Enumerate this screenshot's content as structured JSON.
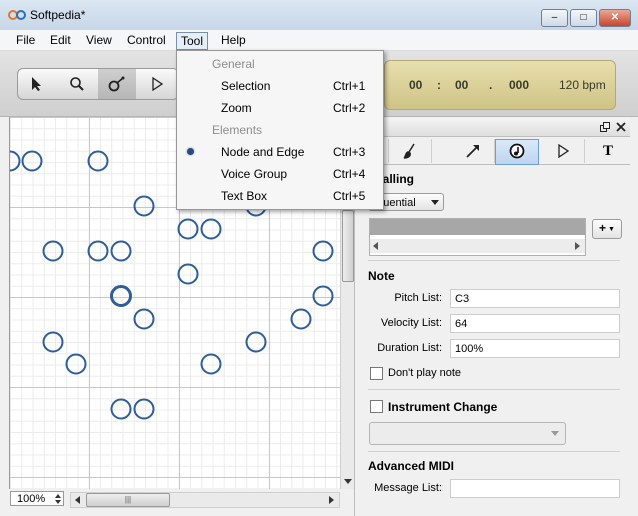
{
  "window": {
    "title": "Softpedia*",
    "buttons": [
      "–",
      "□",
      "✕"
    ]
  },
  "menubar": {
    "items": [
      "File",
      "Edit",
      "View",
      "Control",
      "Tool",
      "Help"
    ]
  },
  "tool_menu": {
    "header_general": "General",
    "selection_label": "Selection",
    "selection_shortcut": "Ctrl+1",
    "zoom_label": "Zoom",
    "zoom_shortcut": "Ctrl+2",
    "header_elements": "Elements",
    "node_label": "Node and Edge",
    "node_shortcut": "Ctrl+3",
    "voice_label": "Voice Group",
    "voice_shortcut": "Ctrl+4",
    "text_label": "Text Box",
    "text_shortcut": "Ctrl+5",
    "selected_item": "Node and Edge"
  },
  "toolbar": {
    "icons": [
      "pointer-icon",
      "zoom-icon",
      "node-edge-icon",
      "play-icon"
    ],
    "time": {
      "hours": "00",
      "sep1": ":",
      "minutes": "00",
      "sep2": ".",
      "millis": "000"
    },
    "tempo": "120 bpm"
  },
  "canvas": {
    "accent": "#2d5d9b",
    "zoom": "100%",
    "hscroll_grip": "|||"
  },
  "panel": {
    "title": "e",
    "tabs": [
      "page-icon",
      "brush-icon",
      "edge-icon",
      "note-icon",
      "play-icon",
      "text-icon"
    ],
    "active_tab": "note-icon",
    "signalling_title": "gnalling",
    "signalling_value": "equential",
    "add_button": "+",
    "note_title": "Note",
    "pitch_label": "Pitch List:",
    "pitch_value": "C3",
    "velocity_label": "Velocity List:",
    "velocity_value": "64",
    "duration_label": "Duration List:",
    "duration_value": "100%",
    "dont_play_label": "Don't play note",
    "instrument_label": "Instrument Change",
    "advanced_title": "Advanced MIDI",
    "message_label": "Message List:",
    "message_value": ""
  }
}
